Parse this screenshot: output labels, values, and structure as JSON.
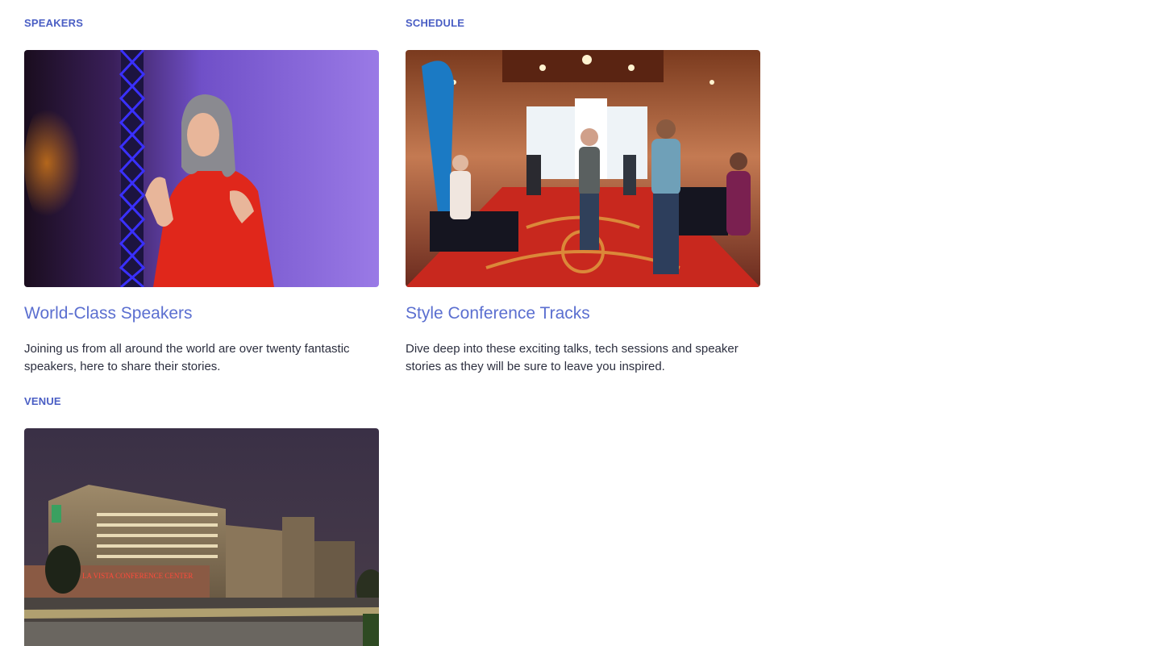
{
  "cards": [
    {
      "eyebrow": "SPEAKERS",
      "title": "World-Class Speakers",
      "text": "Joining us from all around the world are over twenty fantastic speakers, here to share their stories."
    },
    {
      "eyebrow": "SCHEDULE",
      "title": "Style Conference Tracks",
      "text": "Dive deep into these exciting talks, tech sessions and speaker stories as they will be sure to leave you inspired."
    },
    {
      "eyebrow": "VENUE",
      "sign_text": "LA VISTA CONFERENCE CENTER"
    }
  ],
  "colors": {
    "accent": "#4a5ec4",
    "title": "#5b6fd0",
    "body_text": "#2c2f3f"
  }
}
